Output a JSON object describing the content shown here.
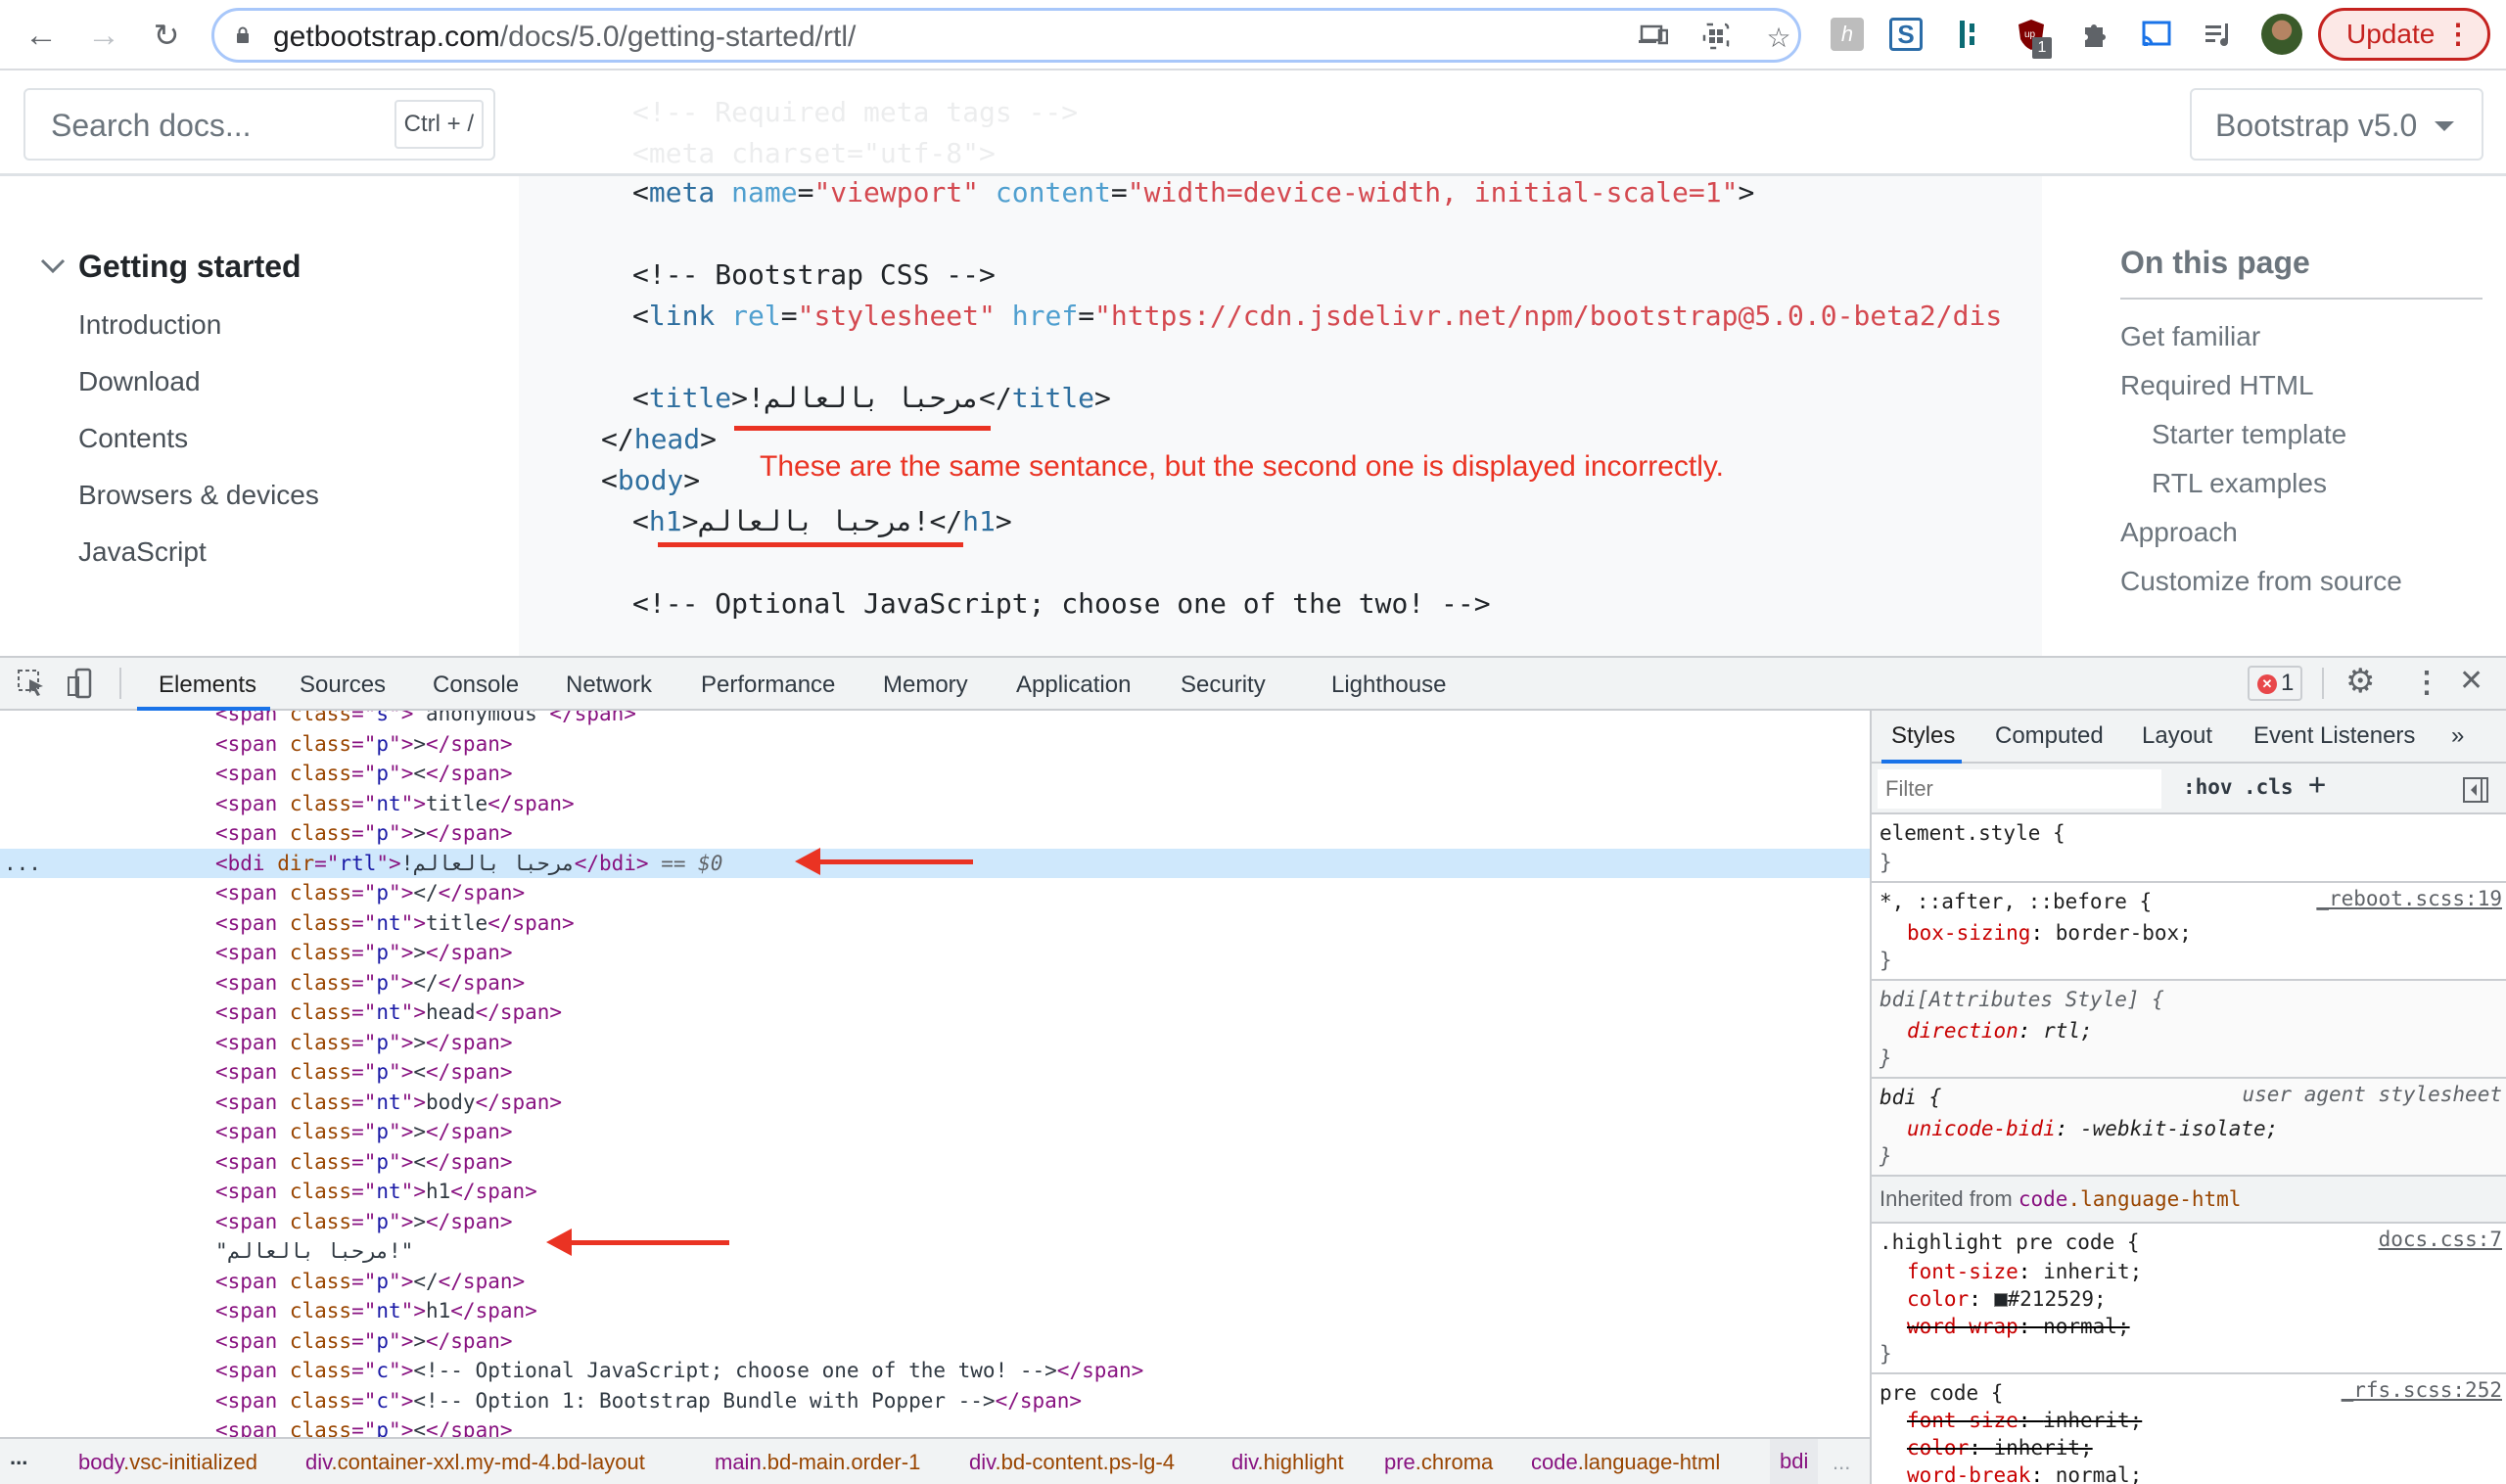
{
  "browser": {
    "url_host": "getbootstrap.com",
    "url_path": "/docs/5.0/getting-started/rtl/",
    "update_label": "Update",
    "extension_badge": "1",
    "icons": [
      "back-icon",
      "forward-icon",
      "reload-icon",
      "lock-icon",
      "cast-icon",
      "qr-icon",
      "bookmark-star-icon",
      "honey-extension-icon",
      "s-extension-icon",
      "tab-extension-icon",
      "ublock-extension-icon",
      "extensions-puzzle-icon",
      "cast-media-icon",
      "media-queue-icon",
      "profile-avatar"
    ]
  },
  "site": {
    "search_placeholder": "Search docs...",
    "search_shortcut": "Ctrl + /",
    "version_label": "Bootstrap v5.0",
    "sidebar": {
      "section": "Getting started",
      "links": [
        "Introduction",
        "Download",
        "Contents",
        "Browsers & devices",
        "JavaScript"
      ]
    },
    "toc": {
      "heading": "On this page",
      "links": [
        {
          "label": "Get familiar",
          "indent": false
        },
        {
          "label": "Required HTML",
          "indent": false
        },
        {
          "label": "Starter template",
          "indent": true
        },
        {
          "label": "RTL examples",
          "indent": true
        },
        {
          "label": "Approach",
          "indent": false
        },
        {
          "label": "Customize from source",
          "indent": false
        }
      ]
    },
    "code": {
      "faded_lines": [
        "<!-- Required meta tags -->",
        "<meta charset=\"utf-8\">"
      ],
      "meta_line": {
        "tag": "meta",
        "attr1": "name",
        "val1": "\"viewport\"",
        "attr2": "content",
        "val2": "\"width=device-width, initial-scale=1\""
      },
      "css_comment": "<!-- Bootstrap CSS -->",
      "link_line": {
        "tag": "link",
        "attr1": "rel",
        "val1": "\"stylesheet\"",
        "attr2": "href",
        "val2": "\"https://cdn.jsdelivr.net/npm/bootstrap@5.0.0-beta2/dis"
      },
      "title_tag": "title",
      "title_text": "مرحبا بالعالم!",
      "head_close": "head",
      "body_open": "body",
      "h1_tag": "h1",
      "h1_text_broken": "ملاعلاب ابحرم!",
      "js_comment": "<!-- Optional JavaScript; choose one of the two! -->"
    },
    "annotation": "These are the same sentance, but the second one is displayed incorrectly."
  },
  "devtools": {
    "tabs": [
      "Elements",
      "Sources",
      "Console",
      "Network",
      "Performance",
      "Memory",
      "Application",
      "Security",
      "Lighthouse"
    ],
    "active_tab": "Elements",
    "error_count": "1",
    "elements_rows": [
      {
        "kind": "span",
        "cls": "s",
        "text": " anonymous "
      },
      {
        "kind": "span",
        "cls": "p",
        "text": ">"
      },
      {
        "kind": "span",
        "cls": "p",
        "text": "<"
      },
      {
        "kind": "span",
        "cls": "nt",
        "text": "title"
      },
      {
        "kind": "span",
        "cls": "p",
        "text": ">"
      },
      {
        "kind": "bdi",
        "dir": "rtl",
        "text": "مرحبا بالعالم!",
        "suffix": " == $0",
        "selected": true
      },
      {
        "kind": "span",
        "cls": "p",
        "text": "</"
      },
      {
        "kind": "span",
        "cls": "nt",
        "text": "title"
      },
      {
        "kind": "span",
        "cls": "p",
        "text": ">"
      },
      {
        "kind": "span",
        "cls": "p",
        "text": "</"
      },
      {
        "kind": "span",
        "cls": "nt",
        "text": "head"
      },
      {
        "kind": "span",
        "cls": "p",
        "text": ">"
      },
      {
        "kind": "span",
        "cls": "p",
        "text": "<"
      },
      {
        "kind": "span",
        "cls": "nt",
        "text": "body"
      },
      {
        "kind": "span",
        "cls": "p",
        "text": ">"
      },
      {
        "kind": "span",
        "cls": "p",
        "text": "<"
      },
      {
        "kind": "span",
        "cls": "nt",
        "text": "h1"
      },
      {
        "kind": "span",
        "cls": "p",
        "text": ">"
      },
      {
        "kind": "text",
        "text": "\"مرحبا بالعالم!\""
      },
      {
        "kind": "span",
        "cls": "p",
        "text": "</"
      },
      {
        "kind": "span",
        "cls": "nt",
        "text": "h1"
      },
      {
        "kind": "span",
        "cls": "p",
        "text": ">"
      },
      {
        "kind": "span",
        "cls": "c",
        "text": "<!-- Optional JavaScript; choose one of the two! -->"
      },
      {
        "kind": "span",
        "cls": "c",
        "text": "<!-- Option 1: Bootstrap Bundle with Popper -->"
      },
      {
        "kind": "span",
        "cls": "p",
        "text": "<"
      }
    ],
    "styles_tabs": [
      "Styles",
      "Computed",
      "Layout",
      "Event Listeners",
      "»"
    ],
    "filter_placeholder": "Filter",
    "hov_label": ":hov",
    "cls_label": ".cls",
    "rules": {
      "element_style": "element.style {",
      "reboot_selector": "*, ::after, ::before {",
      "reboot_src": "_reboot.scss:19",
      "reboot_prop": "box-sizing",
      "reboot_val": "border-box;",
      "attr_selector": "bdi[Attributes Style] {",
      "attr_prop": "direction",
      "attr_val": "rtl;",
      "ua_selector": "bdi {",
      "ua_src": "user agent stylesheet",
      "ua_prop": "unicode-bidi",
      "ua_val": "-webkit-isolate;",
      "inherited_label": "Inherited from",
      "inherited_tag": "code",
      "inherited_cls": ".language-html",
      "hl_selector": ".highlight pre code {",
      "hl_src": "docs.css:7",
      "hl_props": [
        {
          "name": "font-size",
          "val": "inherit;",
          "struck": false
        },
        {
          "name": "color",
          "val": "#212529;",
          "struck": false,
          "swatch": "#212529"
        },
        {
          "name": "word-wrap",
          "val": "normal;",
          "struck": true
        }
      ],
      "pre_selector": "pre code {",
      "pre_src": "_rfs.scss:252",
      "pre_props": [
        {
          "name": "font-size",
          "val": "inherit;",
          "struck": true
        },
        {
          "name": "color",
          "val": "inherit;",
          "struck": true
        },
        {
          "name": "word-break",
          "val": "normal;",
          "struck": false
        }
      ],
      "close_brace": "}"
    },
    "breadcrumbs": [
      {
        "tag": "body",
        "cls": ".vsc-initialized"
      },
      {
        "tag": "div",
        "cls": ".container-xxl.my-md-4.bd-layout"
      },
      {
        "tag": "main",
        "cls": ".bd-main.order-1"
      },
      {
        "tag": "div",
        "cls": ".bd-content.ps-lg-4"
      },
      {
        "tag": "div",
        "cls": ".highlight"
      },
      {
        "tag": "pre",
        "cls": ".chroma"
      },
      {
        "tag": "code",
        "cls": ".language-html"
      },
      {
        "tag": "bdi",
        "cls": ""
      }
    ],
    "ellipsis": "..."
  },
  "colors": {
    "annotation_red": "#ea3323",
    "selection_blue": "#cfe8fc",
    "devtools_accent": "#1a73e8"
  }
}
